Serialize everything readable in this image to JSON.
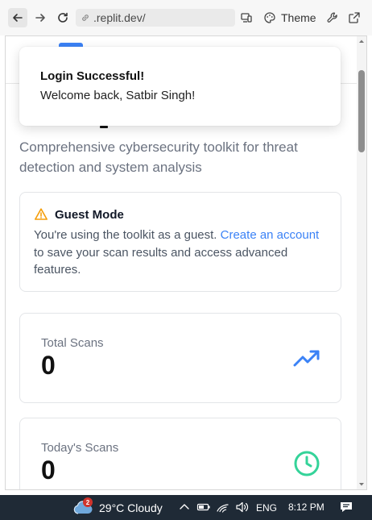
{
  "browser": {
    "url": ".replit.dev/",
    "theme_label": "Theme"
  },
  "toast": {
    "title": "Login Successful!",
    "message": "Welcome back, Satbir Singh!"
  },
  "page": {
    "subtitle": "Comprehensive cybersecurity toolkit for threat detection and system analysis"
  },
  "guest": {
    "title": "Guest Mode",
    "text_before": "You're using the toolkit as a guest. ",
    "link": "Create an account",
    "text_after": " to save your scan results and access advanced features."
  },
  "stats": [
    {
      "label": "Total Scans",
      "value": "0",
      "icon": "trending-up-icon",
      "color": "#3b82f6"
    },
    {
      "label": "Today's Scans",
      "value": "0",
      "icon": "clock-icon",
      "color": "#34d399"
    }
  ],
  "taskbar": {
    "weather_badge": "2",
    "weather": "29°C  Cloudy",
    "lang": "ENG",
    "time": "8:12 PM"
  },
  "colors": {
    "accent": "#3b82f6",
    "warning": "#f59e0b",
    "success": "#34d399",
    "taskbar": "#1f2a36"
  }
}
